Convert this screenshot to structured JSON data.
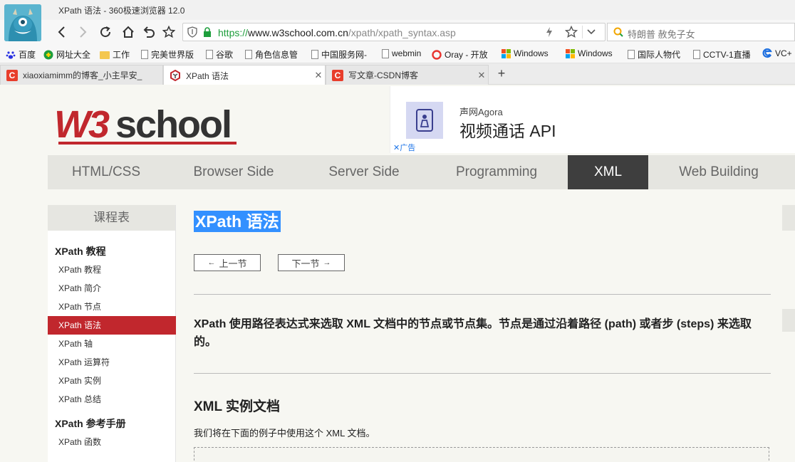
{
  "window": {
    "title": "XPath 语法 - 360极速浏览器 12.0"
  },
  "toolbar": {
    "url_scheme": "https://",
    "url_host": "www.w3school.com.cn",
    "url_path": "/xpath/xpath_syntax.asp",
    "search_text": "特朗普 赦免子女"
  },
  "bookmarks": [
    {
      "label": "百度",
      "icon": "paw-icon"
    },
    {
      "label": "网址大全",
      "icon": "globe-icon"
    },
    {
      "label": "工作",
      "icon": "folder-icon"
    },
    {
      "label": "完美世界版",
      "icon": "doc-icon"
    },
    {
      "label": "谷歌",
      "icon": "doc-icon"
    },
    {
      "label": "角色信息管",
      "icon": "doc-icon"
    },
    {
      "label": "中国服务网-",
      "icon": "doc-icon"
    },
    {
      "label": "webmin",
      "icon": "doc-icon"
    },
    {
      "label": "Oray - 开放",
      "icon": "oray-icon"
    },
    {
      "label": "Windows",
      "icon": "windows-icon"
    },
    {
      "label": "Windows",
      "icon": "windows-icon"
    },
    {
      "label": "国际人物代",
      "icon": "doc-icon"
    },
    {
      "label": "CCTV-1直播",
      "icon": "doc-icon"
    },
    {
      "label": "VC+",
      "icon": "edge-icon"
    }
  ],
  "tabs": [
    {
      "label": "xiaoxiamimm的博客_小主早安_",
      "favicon": "C",
      "favicon_color": "#e83d2b",
      "active": false
    },
    {
      "label": "XPath 语法",
      "favicon": "W3",
      "favicon_color": "#c1272d",
      "active": true
    },
    {
      "label": "写文章-CSDN博客",
      "favicon": "C",
      "favicon_color": "#e83d2b",
      "active": false
    }
  ],
  "page": {
    "ad": {
      "brand": "声网Agora",
      "title": "视频通话 API",
      "mark": "广告"
    },
    "nav": [
      "HTML/CSS",
      "Browser Side",
      "Server Side",
      "Programming",
      "XML",
      "Web Building"
    ],
    "nav_active": "XML",
    "sidebar": {
      "title": "课程表",
      "section1": "XPath 教程",
      "links1": [
        "XPath 教程",
        "XPath 简介",
        "XPath 节点",
        "XPath 语法",
        "XPath 轴",
        "XPath 运算符",
        "XPath 实例",
        "XPath 总结"
      ],
      "active_link": "XPath 语法",
      "section2": "XPath 参考手册",
      "links2": [
        "XPath 函数"
      ]
    },
    "content": {
      "title": "XPath 语法",
      "prev": "上一节",
      "next": "下一节",
      "intro": "XPath 使用路径表达式来选取 XML 文档中的节点或节点集。节点是通过沿着路径 (path) 或者步 (steps) 来选取的。",
      "h2": "XML 实例文档",
      "p1": "我们将在下面的例子中使用这个 XML 文档。"
    }
  },
  "colors": {
    "brand_red": "#c1272d",
    "selection_blue": "#3390ff",
    "nav_active_bg": "#3e3e3e",
    "url_green": "#1e9e3c"
  }
}
